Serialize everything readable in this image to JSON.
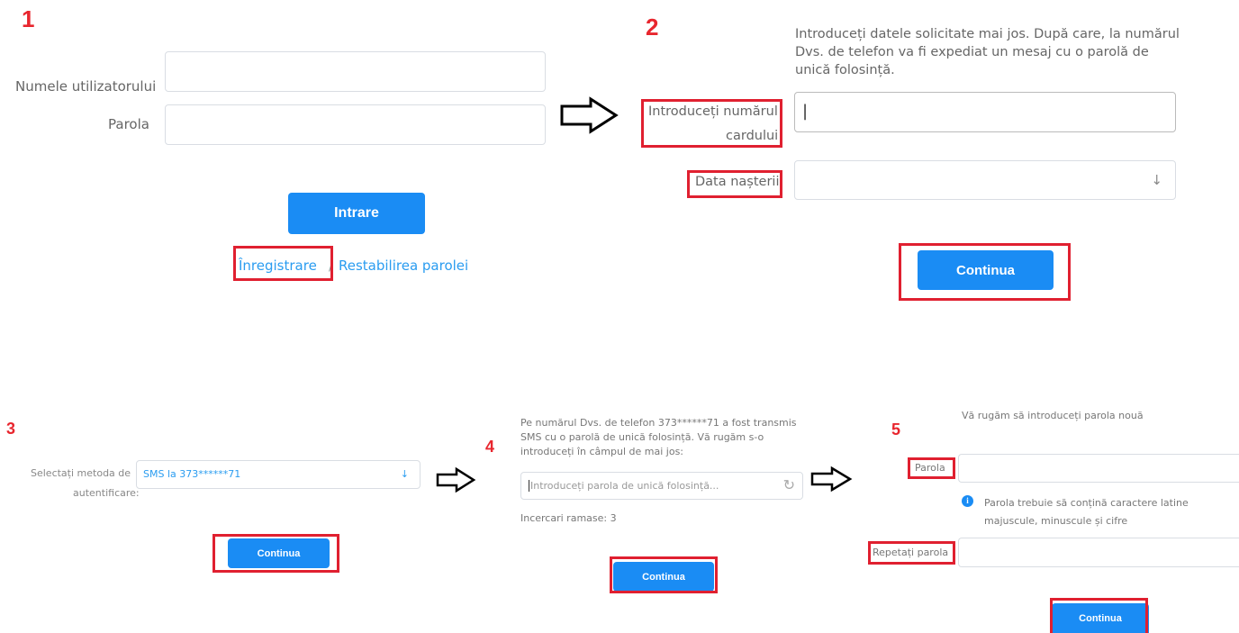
{
  "step1": {
    "number": "1",
    "username_label": "Numele utilizatorului",
    "username_value": "",
    "password_label": "Parola",
    "password_value": "",
    "login_button": "Intrare",
    "register_link": "Înregistrare",
    "separator": "/",
    "restore_link": "Restabilirea parolei"
  },
  "step2": {
    "number": "2",
    "intro": "Introduceți datele solicitate mai jos. După care, la numărul Dvs. de telefon va fi expediat un mesaj cu o parolă de unică folosință.",
    "card_label_line1": "Introduceți numărul",
    "card_label_line2": "cardului",
    "card_value": "|",
    "birth_label": "Data nașterii",
    "birth_arrow": "↓",
    "continue_button": "Continua"
  },
  "step3": {
    "number": "3",
    "method_label_line1": "Selectați metoda de",
    "method_label_line2": "autentificare:",
    "method_value": "SMS la 373******71",
    "method_arrow": "↓",
    "continue_button": "Continua"
  },
  "step4": {
    "number": "4",
    "info": "Pe numărul Dvs. de telefon 373******71 a fost transmis SMS cu o parolă de unică folosință. Vă rugăm s-o introduceți în câmpul de mai jos:",
    "otp_placeholder": "Introduceți parola de unică folosință...",
    "refresh_icon": "↻",
    "attempts": "Incercari ramase: 3",
    "continue_button": "Continua"
  },
  "step5": {
    "number": "5",
    "heading": "Vă rugăm să introduceți parola nouă",
    "password_label": "Parola",
    "hint": "Parola trebuie să conțină caractere latine majuscule, minuscule și cifre",
    "info_icon": "i",
    "repeat_label": "Repetați parola",
    "continue_button": "Continua"
  },
  "colors": {
    "accent": "#1a8cf4",
    "highlight": "#e02030",
    "step_number": "#e8262e",
    "link": "#2a9cf0"
  }
}
